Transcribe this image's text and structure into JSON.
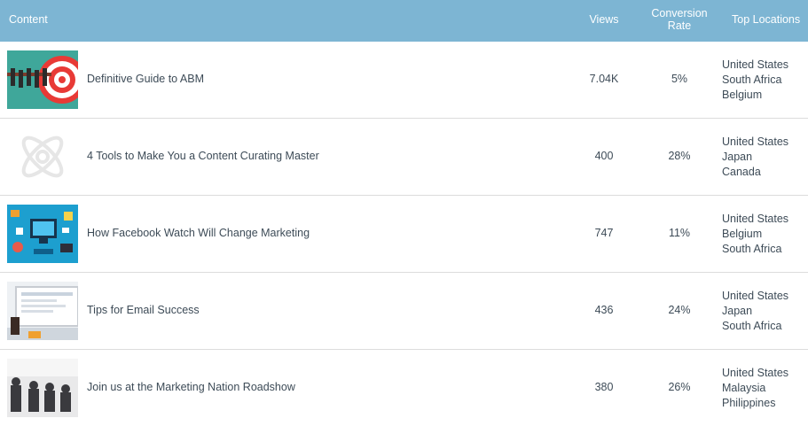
{
  "header": {
    "content": "Content",
    "views": "Views",
    "conversion_line1": "Conversion",
    "conversion_line2": "Rate",
    "locations": "Top Locations"
  },
  "rows": [
    {
      "title": "Definitive Guide to ABM",
      "views": "7.04K",
      "conversion": "5%",
      "locations": [
        "United States",
        "South Africa",
        "Belgium"
      ],
      "thumb": "target-people-thumbnail"
    },
    {
      "title": "4 Tools to Make You a Content Curating Master",
      "views": "400",
      "conversion": "28%",
      "locations": [
        "United States",
        "Japan",
        "Canada"
      ],
      "thumb": "atom-placeholder-icon"
    },
    {
      "title": "How Facebook Watch Will Change Marketing",
      "views": "747",
      "conversion": "11%",
      "locations": [
        "United States",
        "Belgium",
        "South Africa"
      ],
      "thumb": "marketing-icons-thumbnail"
    },
    {
      "title": "Tips for Email Success",
      "views": "436",
      "conversion": "24%",
      "locations": [
        "United States",
        "Japan",
        "South Africa"
      ],
      "thumb": "computer-desk-thumbnail"
    },
    {
      "title": "Join us at the Marketing Nation Roadshow",
      "views": "380",
      "conversion": "26%",
      "locations": [
        "United States",
        "Malaysia",
        "Philippines"
      ],
      "thumb": "audience-photo-thumbnail"
    }
  ],
  "colors": {
    "header_bg": "#7db5d3",
    "text": "#3d4b57"
  }
}
